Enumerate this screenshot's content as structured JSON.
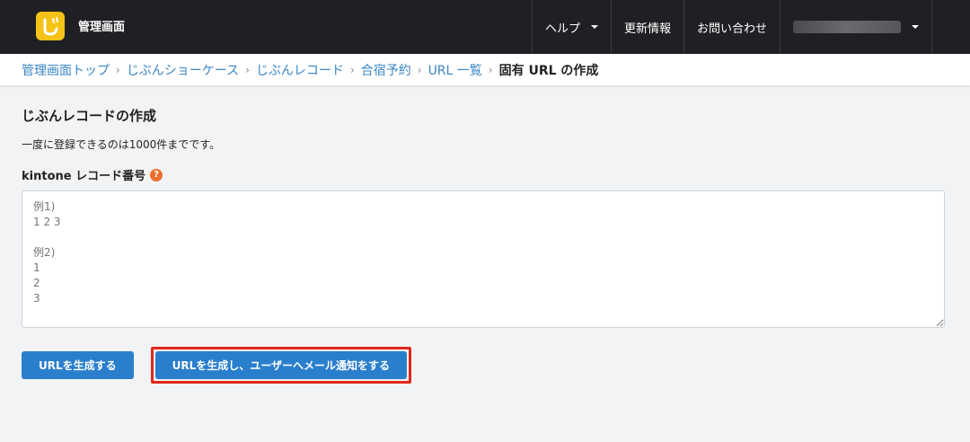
{
  "header": {
    "brand": "管理画面",
    "nav": [
      {
        "label": "ヘルプ",
        "dropdown": true
      },
      {
        "label": "更新情報",
        "dropdown": false
      },
      {
        "label": "お問い合わせ",
        "dropdown": false
      }
    ],
    "user_menu_icon": "chevron-down-icon"
  },
  "breadcrumb": {
    "items": [
      "管理画面トップ",
      "じぶんショーケース",
      "じぶんレコード",
      "合宿予約",
      "URL 一覧"
    ],
    "current": "固有 URL の作成",
    "separator": "›"
  },
  "main": {
    "title": "じぶんレコードの作成",
    "description": "一度に登録できるのは1000件までです。",
    "field_label": "kintone レコード番号",
    "help_icon": "?",
    "textarea_placeholder": "例1)\n1 2 3\n\n例2)\n1\n2\n3",
    "textarea_value": ""
  },
  "actions": {
    "generate_url": "URLを生成する",
    "generate_and_notify": "URLを生成し、ユーザーへメール通知をする"
  },
  "colors": {
    "header_bg": "#1f2023",
    "accent": "#2a7fcd",
    "highlight": "#e0281e",
    "link": "#3a86c6",
    "logo": "#f5c217"
  }
}
